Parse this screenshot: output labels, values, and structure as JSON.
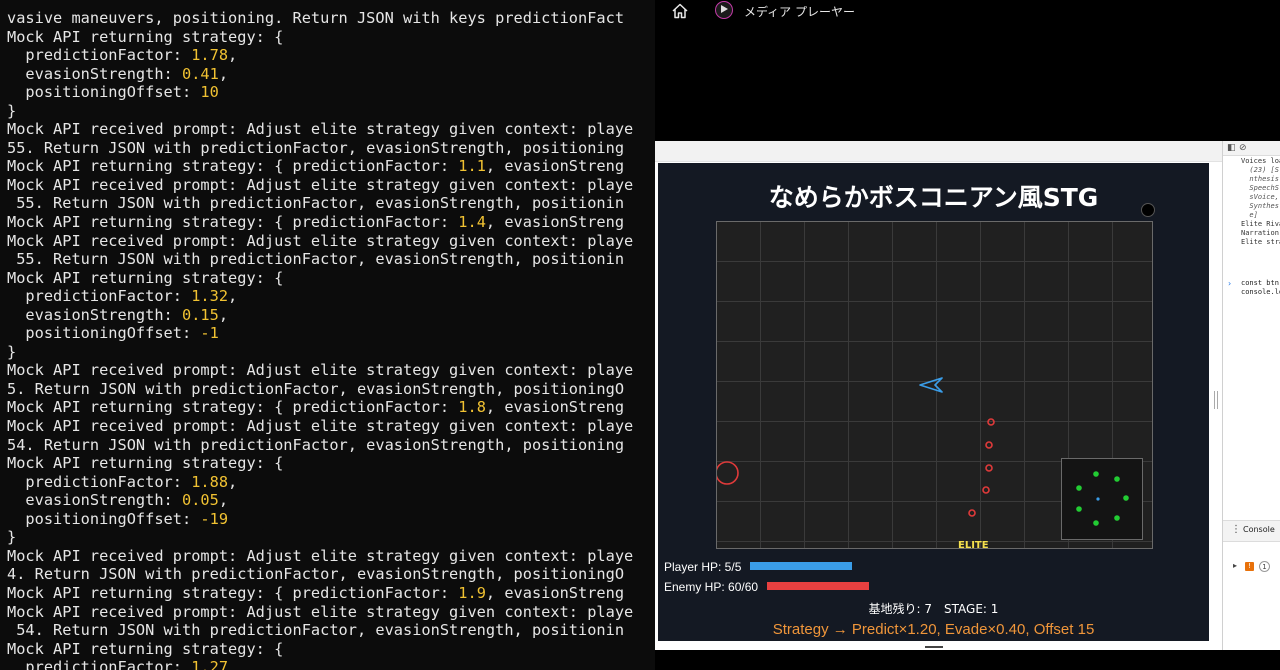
{
  "terminal": {
    "lines": [
      [
        {
          "t": "vasive maneuvers, positioning. Return JSON with keys predictionFact"
        }
      ],
      [
        {
          "t": "Mock API returning strategy: {"
        }
      ],
      [
        {
          "t": "  predictionFactor: "
        },
        {
          "t": "1.78",
          "n": true
        },
        {
          "t": ","
        }
      ],
      [
        {
          "t": "  evasionStrength: "
        },
        {
          "t": "0.41",
          "n": true
        },
        {
          "t": ","
        }
      ],
      [
        {
          "t": "  positioningOffset: "
        },
        {
          "t": "10",
          "n": true
        }
      ],
      [
        {
          "t": "}"
        }
      ],
      [
        {
          "t": "Mock API received prompt: Adjust elite strategy given context: playe"
        }
      ],
      [
        {
          "t": "55. Return JSON with predictionFactor, evasionStrength, positioning"
        }
      ],
      [
        {
          "t": "Mock API returning strategy: { predictionFactor: "
        },
        {
          "t": "1.1",
          "n": true
        },
        {
          "t": ", evasionStreng"
        }
      ],
      [
        {
          "t": "Mock API received prompt: Adjust elite strategy given context: playe"
        }
      ],
      [
        {
          "t": " 55. Return JSON with predictionFactor, evasionStrength, positionin"
        }
      ],
      [
        {
          "t": "Mock API returning strategy: { predictionFactor: "
        },
        {
          "t": "1.4",
          "n": true
        },
        {
          "t": ", evasionStreng"
        }
      ],
      [
        {
          "t": "Mock API received prompt: Adjust elite strategy given context: playe"
        }
      ],
      [
        {
          "t": " 55. Return JSON with predictionFactor, evasionStrength, positionin"
        }
      ],
      [
        {
          "t": "Mock API returning strategy: {"
        }
      ],
      [
        {
          "t": "  predictionFactor: "
        },
        {
          "t": "1.32",
          "n": true
        },
        {
          "t": ","
        }
      ],
      [
        {
          "t": "  evasionStrength: "
        },
        {
          "t": "0.15",
          "n": true
        },
        {
          "t": ","
        }
      ],
      [
        {
          "t": "  positioningOffset: "
        },
        {
          "t": "-1",
          "n": true
        }
      ],
      [
        {
          "t": "}"
        }
      ],
      [
        {
          "t": "Mock API received prompt: Adjust elite strategy given context: playe"
        }
      ],
      [
        {
          "t": "5. Return JSON with predictionFactor, evasionStrength, positioningO"
        }
      ],
      [
        {
          "t": "Mock API returning strategy: { predictionFactor: "
        },
        {
          "t": "1.8",
          "n": true
        },
        {
          "t": ", evasionStreng"
        }
      ],
      [
        {
          "t": "Mock API received prompt: Adjust elite strategy given context: playe"
        }
      ],
      [
        {
          "t": "54. Return JSON with predictionFactor, evasionStrength, positioning"
        }
      ],
      [
        {
          "t": "Mock API returning strategy: {"
        }
      ],
      [
        {
          "t": "  predictionFactor: "
        },
        {
          "t": "1.88",
          "n": true
        },
        {
          "t": ","
        }
      ],
      [
        {
          "t": "  evasionStrength: "
        },
        {
          "t": "0.05",
          "n": true
        },
        {
          "t": ","
        }
      ],
      [
        {
          "t": "  positioningOffset: "
        },
        {
          "t": "-19",
          "n": true
        }
      ],
      [
        {
          "t": "}"
        }
      ],
      [
        {
          "t": "Mock API received prompt: Adjust elite strategy given context: playe"
        }
      ],
      [
        {
          "t": "4. Return JSON with predictionFactor, evasionStrength, positioningO"
        }
      ],
      [
        {
          "t": "Mock API returning strategy: { predictionFactor: "
        },
        {
          "t": "1.9",
          "n": true
        },
        {
          "t": ", evasionStreng"
        }
      ],
      [
        {
          "t": "Mock API received prompt: Adjust elite strategy given context: playe"
        }
      ],
      [
        {
          "t": " 54. Return JSON with predictionFactor, evasionStrength, positionin"
        }
      ],
      [
        {
          "t": "Mock API returning strategy: {"
        }
      ],
      [
        {
          "t": "  predictionFactor: "
        },
        {
          "t": "1.27",
          "n": true
        }
      ]
    ],
    "number_color": "#f1c232"
  },
  "media_player": {
    "title": "メディア プレーヤー",
    "icons": [
      "home-icon",
      "media-player-icon"
    ]
  },
  "game": {
    "title": "なめらかボスコニアン風STG",
    "elite_label": "ELITE",
    "player_hp": {
      "label": "Player HP: 5/5",
      "current": 5,
      "max": 5,
      "color": "#3a9de8"
    },
    "enemy_hp": {
      "label": "Enemy HP: 60/60",
      "current": 60,
      "max": 60,
      "color": "#e84040"
    },
    "status": "基地残り: 7　STAGE: 1",
    "strategy": "Strategy → Predict×1.20, Evade×0.40, Offset 15",
    "strategy_color": "#f0963a"
  },
  "devtools": {
    "log_lines": [
      {
        "t": "Voices loa",
        "i": false
      },
      {
        "t": "  (23) [S",
        "i": true
      },
      {
        "t": "  nthesis",
        "i": true
      },
      {
        "t": "  SpeechS",
        "i": true
      },
      {
        "t": "  sVoice,",
        "i": true
      },
      {
        "t": "  Synthes",
        "i": true
      },
      {
        "t": "  e]",
        "i": true
      },
      {
        "t": "Elite Riva",
        "i": false
      },
      {
        "t": "Narration",
        "i": false
      },
      {
        "t": "Elite stra",
        "i": false
      }
    ],
    "console_input": "const btn\nconsole.lo",
    "drawer_tab": "Console",
    "issue_count": "1"
  }
}
